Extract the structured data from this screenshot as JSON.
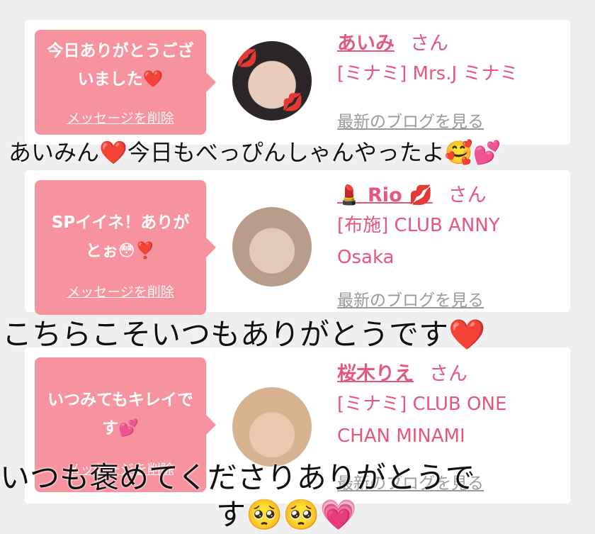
{
  "accent": "#e6567d",
  "bubble_color": "#f7939f",
  "cards": [
    {
      "message": "今日ありがとうございました❤️",
      "delete_label": "メッセージを削除",
      "name": "あいみ",
      "honorific": "さん",
      "shop": "[ミナミ] Mrs.J ミナミ",
      "blog_label": "最新のブログを見る"
    },
    {
      "message": "SPイイネ！ありがとぉ😳❣️",
      "delete_label": "メッセージを削除",
      "name": "💄 Rio 💋",
      "honorific": "さん",
      "shop": "[布施] CLUB ANNY Osaka",
      "blog_label": "最新のブログを見る"
    },
    {
      "message": "いつみてもキレイです💕",
      "delete_label": "メッセージを削除",
      "name": "桜木りえ",
      "honorific": "さん",
      "shop": "[ミナミ] CLUB ONE CHAN MINAMI",
      "blog_label": "最新のブログを見る"
    }
  ],
  "overlay": {
    "caption_1": "あいみん❤️今日もべっぴんしゃんやったよ🥰💕",
    "caption_2": "こちらこそいつもありがとうです❤️",
    "caption_3a": "いつも褒めてくださりありがとうで",
    "caption_3b": "す🥺🥺💗"
  }
}
